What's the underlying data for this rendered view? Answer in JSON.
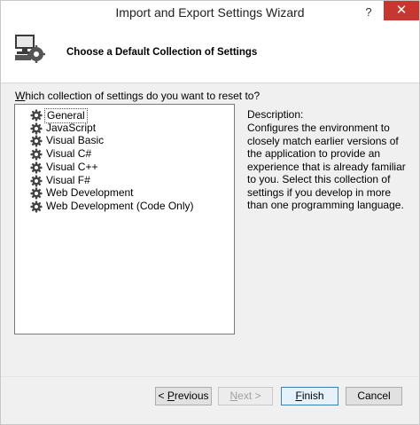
{
  "window": {
    "title": "Import and Export Settings Wizard",
    "help_label": "?",
    "close_label": "✕"
  },
  "header": {
    "title": "Choose a Default Collection of Settings"
  },
  "prompt": {
    "underlined_char": "W",
    "rest": "hich collection of settings do you want to reset to?"
  },
  "collections": {
    "items": [
      {
        "label": "General",
        "selected": true
      },
      {
        "label": "JavaScript",
        "selected": false
      },
      {
        "label": "Visual Basic",
        "selected": false
      },
      {
        "label": "Visual C#",
        "selected": false
      },
      {
        "label": "Visual C++",
        "selected": false
      },
      {
        "label": "Visual F#",
        "selected": false
      },
      {
        "label": "Web Development",
        "selected": false
      },
      {
        "label": "Web Development (Code Only)",
        "selected": false
      }
    ],
    "icon": "gear-icon"
  },
  "description": {
    "title": "Description:",
    "text": "Configures the environment to closely match earlier versions of the application to provide an experience that is already familiar to you. Select this collection of settings if you develop in more than one programming language."
  },
  "buttons": {
    "previous": {
      "prefix": "< ",
      "u": "P",
      "rest": "revious"
    },
    "next": {
      "prefix": "",
      "u": "N",
      "rest": "ext >"
    },
    "finish": {
      "prefix": "",
      "u": "F",
      "rest": "inish"
    },
    "cancel": {
      "prefix": "",
      "u": "",
      "rest": "Cancel"
    }
  }
}
